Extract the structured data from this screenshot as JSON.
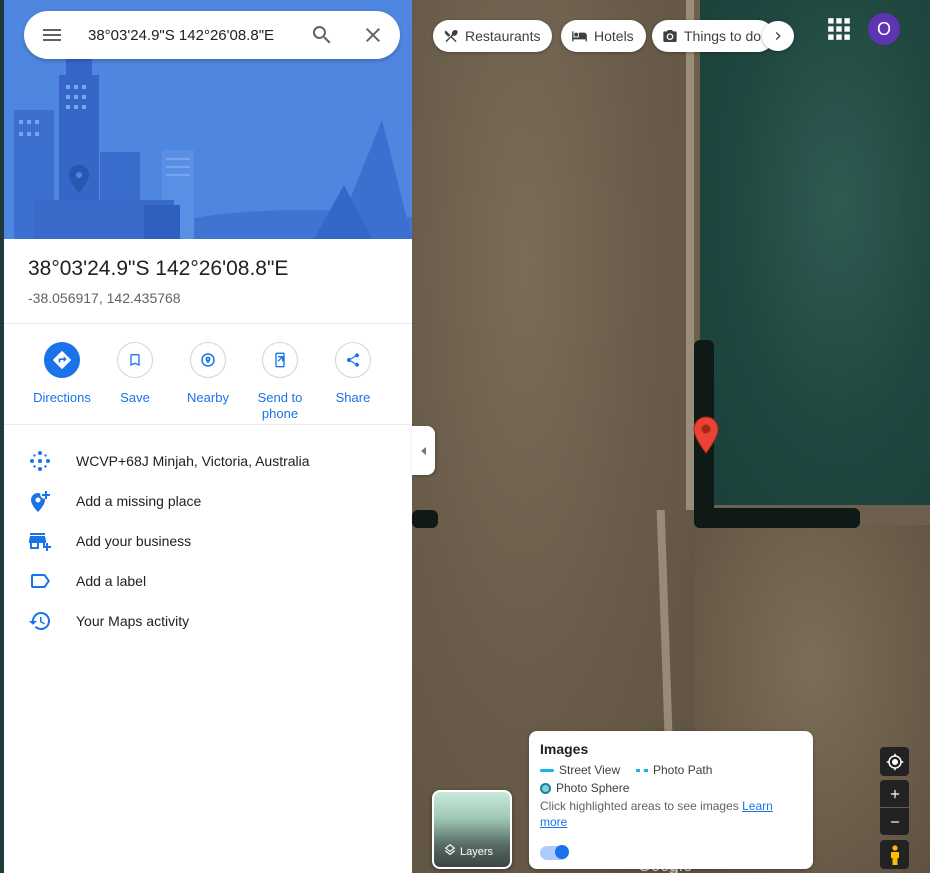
{
  "search": {
    "query": "38°03'24.9\"S 142°26'08.8\"E"
  },
  "place": {
    "title": "38°03'24.9\"S 142°26'08.8\"E",
    "coordinates": "-38.056917, 142.435768"
  },
  "actions": [
    {
      "label": "Directions",
      "icon": "directions-icon"
    },
    {
      "label": "Save",
      "icon": "bookmark-icon"
    },
    {
      "label": "Nearby",
      "icon": "nearby-icon"
    },
    {
      "label": "Send to phone",
      "icon": "send-to-phone-icon"
    },
    {
      "label": "Share",
      "icon": "share-icon"
    }
  ],
  "info_rows": [
    {
      "label": "WCVP+68J Minjah, Victoria, Australia",
      "icon": "plus-code-icon"
    },
    {
      "label": "Add a missing place",
      "icon": "add-place-icon"
    },
    {
      "label": "Add your business",
      "icon": "add-business-icon"
    },
    {
      "label": "Add a label",
      "icon": "label-icon"
    },
    {
      "label": "Your Maps activity",
      "icon": "history-icon"
    }
  ],
  "chips": [
    {
      "label": "Restaurants",
      "icon": "restaurant-icon"
    },
    {
      "label": "Hotels",
      "icon": "hotel-icon"
    },
    {
      "label": "Things to do",
      "icon": "camera-icon"
    }
  ],
  "account": {
    "initial": "O",
    "color": "#5e35b1"
  },
  "layers": {
    "label": "Layers"
  },
  "images_card": {
    "title": "Images",
    "street_view": "Street View",
    "photo_path": "Photo Path",
    "photo_sphere": "Photo Sphere",
    "hint": "Click highlighted areas to see images",
    "learn_more": "Learn more"
  },
  "branding": "Google",
  "colors": {
    "accent": "#1a73e8",
    "pin": "#ea4335"
  }
}
